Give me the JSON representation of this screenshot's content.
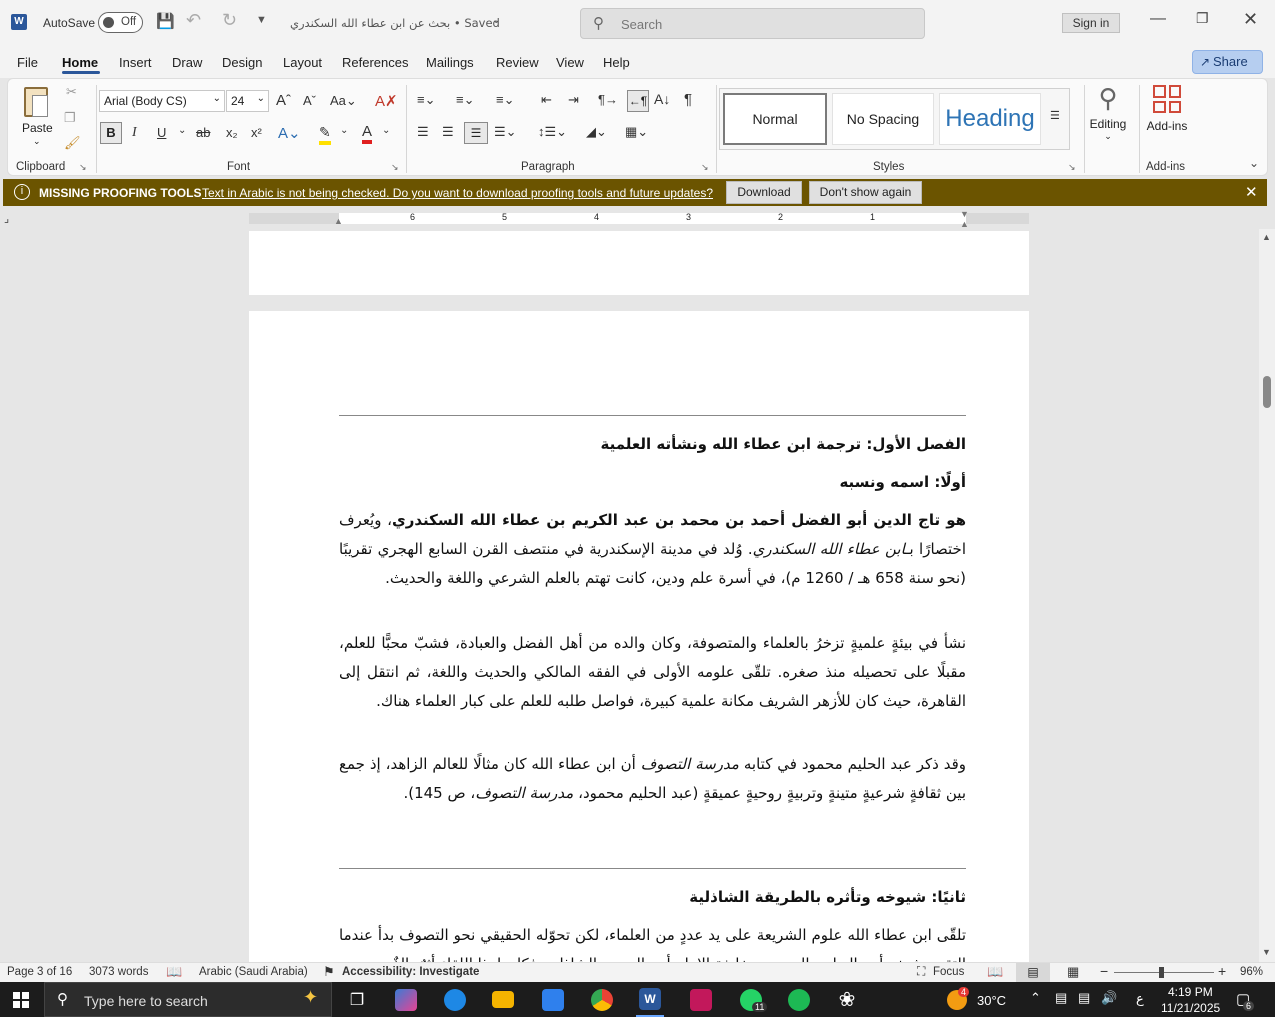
{
  "titlebar": {
    "autosave_label": "AutoSave",
    "autosave_state": "Off",
    "doc_title": "بحث عن ابن عطاء الله السكندري • Saved",
    "search_placeholder": "Search",
    "signin_label": "Sign in"
  },
  "menu": {
    "items": [
      "File",
      "Home",
      "Insert",
      "Draw",
      "Design",
      "Layout",
      "References",
      "Mailings",
      "Review",
      "View",
      "Help"
    ],
    "active": "Home",
    "share_label": "Share"
  },
  "ribbon": {
    "clipboard": {
      "paste_label": "Paste",
      "group_label": "Clipboard"
    },
    "font": {
      "font_name": "Arial (Body CS)",
      "font_size": "24",
      "group_label": "Font"
    },
    "paragraph": {
      "group_label": "Paragraph"
    },
    "styles": {
      "items": [
        "Normal",
        "No Spacing",
        "Heading"
      ],
      "group_label": "Styles"
    },
    "editing": {
      "label": "Editing"
    },
    "addins": {
      "label": "Add-ins",
      "group_label": "Add-ins"
    },
    "accent": "#2b579a"
  },
  "infobar": {
    "title": "MISSING PROOFING TOOLS",
    "message": "Text in Arabic is not being checked. Do you want to download proofing tools and future updates?",
    "download_label": "Download",
    "dont_show_label": "Don't show again",
    "bg_color": "#6b5400"
  },
  "ruler": {
    "numbers": [
      "6",
      "5",
      "4",
      "3",
      "2",
      "1"
    ]
  },
  "document": {
    "chapter_title": "الفصل الأول: ترجمة ابن عطاء الله ونشأته العلمية",
    "section1_title": "أولًا: اسمه ونسبه",
    "p1_bold": "هو تاج الدين أبو الفضل أحمد بن محمد بن عبد الكريم بن عطاء الله السكندري",
    "p1_mid": "، ويُعرف اختصارًا بـ",
    "p1_italic": "ابن عطاء الله السكندري",
    "p1_rest": ". وُلد في مدينة الإسكندرية في منتصف القرن السابع الهجري تقريبًا (نحو سنة 658 هـ / 1260 م)، في أسرة علم ودين، كانت تهتم بالعلم الشرعي واللغة والحديث.",
    "p2": "نشأ في بيئةٍ علميةٍ تزخرُ بالعلماء والمتصوفة، وكان والده من أهل الفضل والعبادة، فشبّ محبًّا للعلم، مقبلًا على تحصيله منذ صغره. تلقّى علومه الأولى في الفقه المالكي والحديث واللغة، ثم انتقل إلى القاهرة، حيث كان للأزهر الشريف مكانة علمية كبيرة، فواصل طلبه للعلم على كبار العلماء هناك.",
    "p3_a": "وقد ذكر عبد الحليم محمود في كتابه ",
    "p3_italic": "مدرسة التصوف",
    "p3_b": " أن ابن عطاء الله كان مثالًا للعالم الزاهد، إذ جمع بين ثقافةٍ شرعيةٍ متينةٍ وتربيةٍ روحيةٍ عميقةٍ (عبد الحليم محمود، ",
    "p3_italic2": "مدرسة التصوف",
    "p3_c": "، ص 145).",
    "section2_title": "ثانيًا: شيوخه وتأثره بالطريقة الشاذلية",
    "p4": "تلقّى ابن عطاء الله علوم الشريعة على يد عددٍ من العلماء، لكن تحوّله الحقيقي نحو التصوف بدأ عندما التقى بشيخه أبي العباس المرسي، خليفة الإمام أبي الحسن الشاذلي، فكان لهذا اللقاء أثرٌ بالغٌ"
  },
  "statusbar": {
    "page": "Page 3 of 16",
    "words": "3073 words",
    "language": "Arabic (Saudi Arabia)",
    "accessibility": "Accessibility: Investigate",
    "focus": "Focus",
    "zoom": "96%"
  },
  "taskbar": {
    "search_placeholder": "Type here to search",
    "whatsapp_badge": "11",
    "weather_badge": "4",
    "temperature": "30°C",
    "lang": "ع",
    "time": "4:19 PM",
    "date": "11/21/2025",
    "notif_badge": "6"
  }
}
